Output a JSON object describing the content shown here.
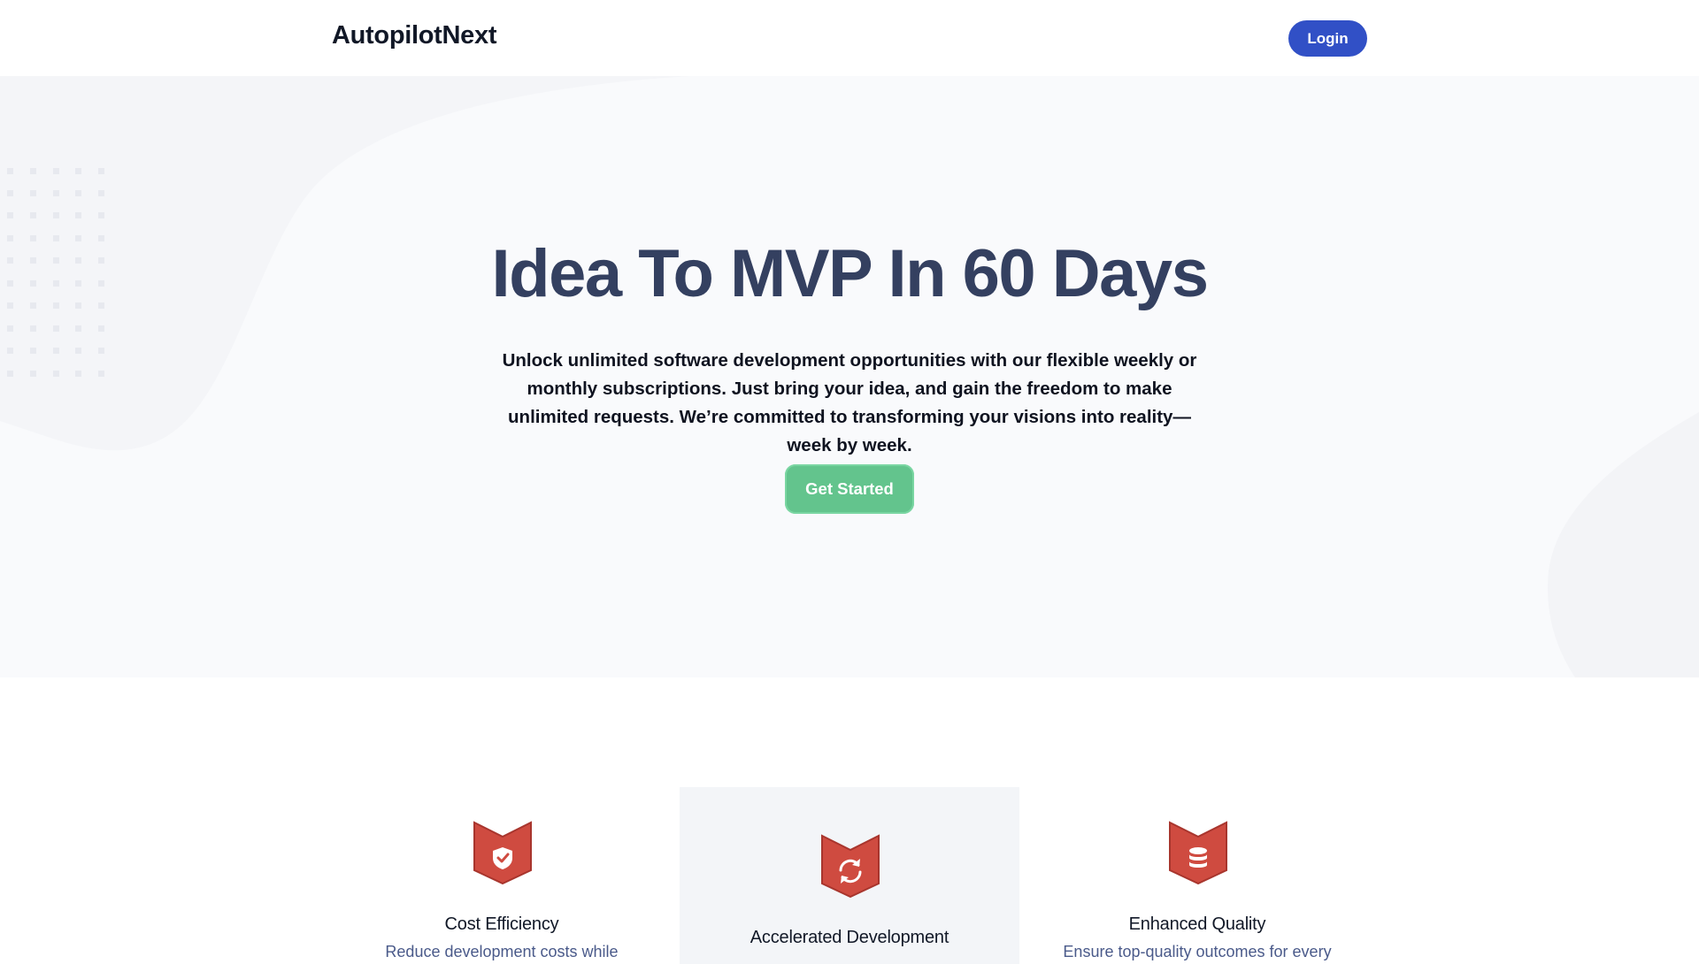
{
  "header": {
    "brand": "AutopilotNext",
    "login_label": "Login",
    "login_color": "#3150c6"
  },
  "hero": {
    "title": "Idea To MVP In 60 Days",
    "description": "Unlock unlimited software development opportunities with our flexible weekly or monthly subscriptions. Just bring your idea, and gain the freedom to make unlimited requests. We’re committed to transforming your visions into reality—week by week.",
    "cta_label": "Get Started",
    "cta_color": "#63c48d"
  },
  "features": [
    {
      "icon": "shield-check-icon",
      "title": "Cost Efficiency",
      "desc": "Reduce development costs while"
    },
    {
      "icon": "refresh-icon",
      "title": "Accelerated Development",
      "desc": ""
    },
    {
      "icon": "database-icon",
      "title": "Enhanced Quality",
      "desc": "Ensure top-quality outcomes for every"
    }
  ],
  "colors": {
    "icon_badge": "#cf4b40",
    "hero_background": "#f9fafc",
    "title_color": "#344060"
  }
}
